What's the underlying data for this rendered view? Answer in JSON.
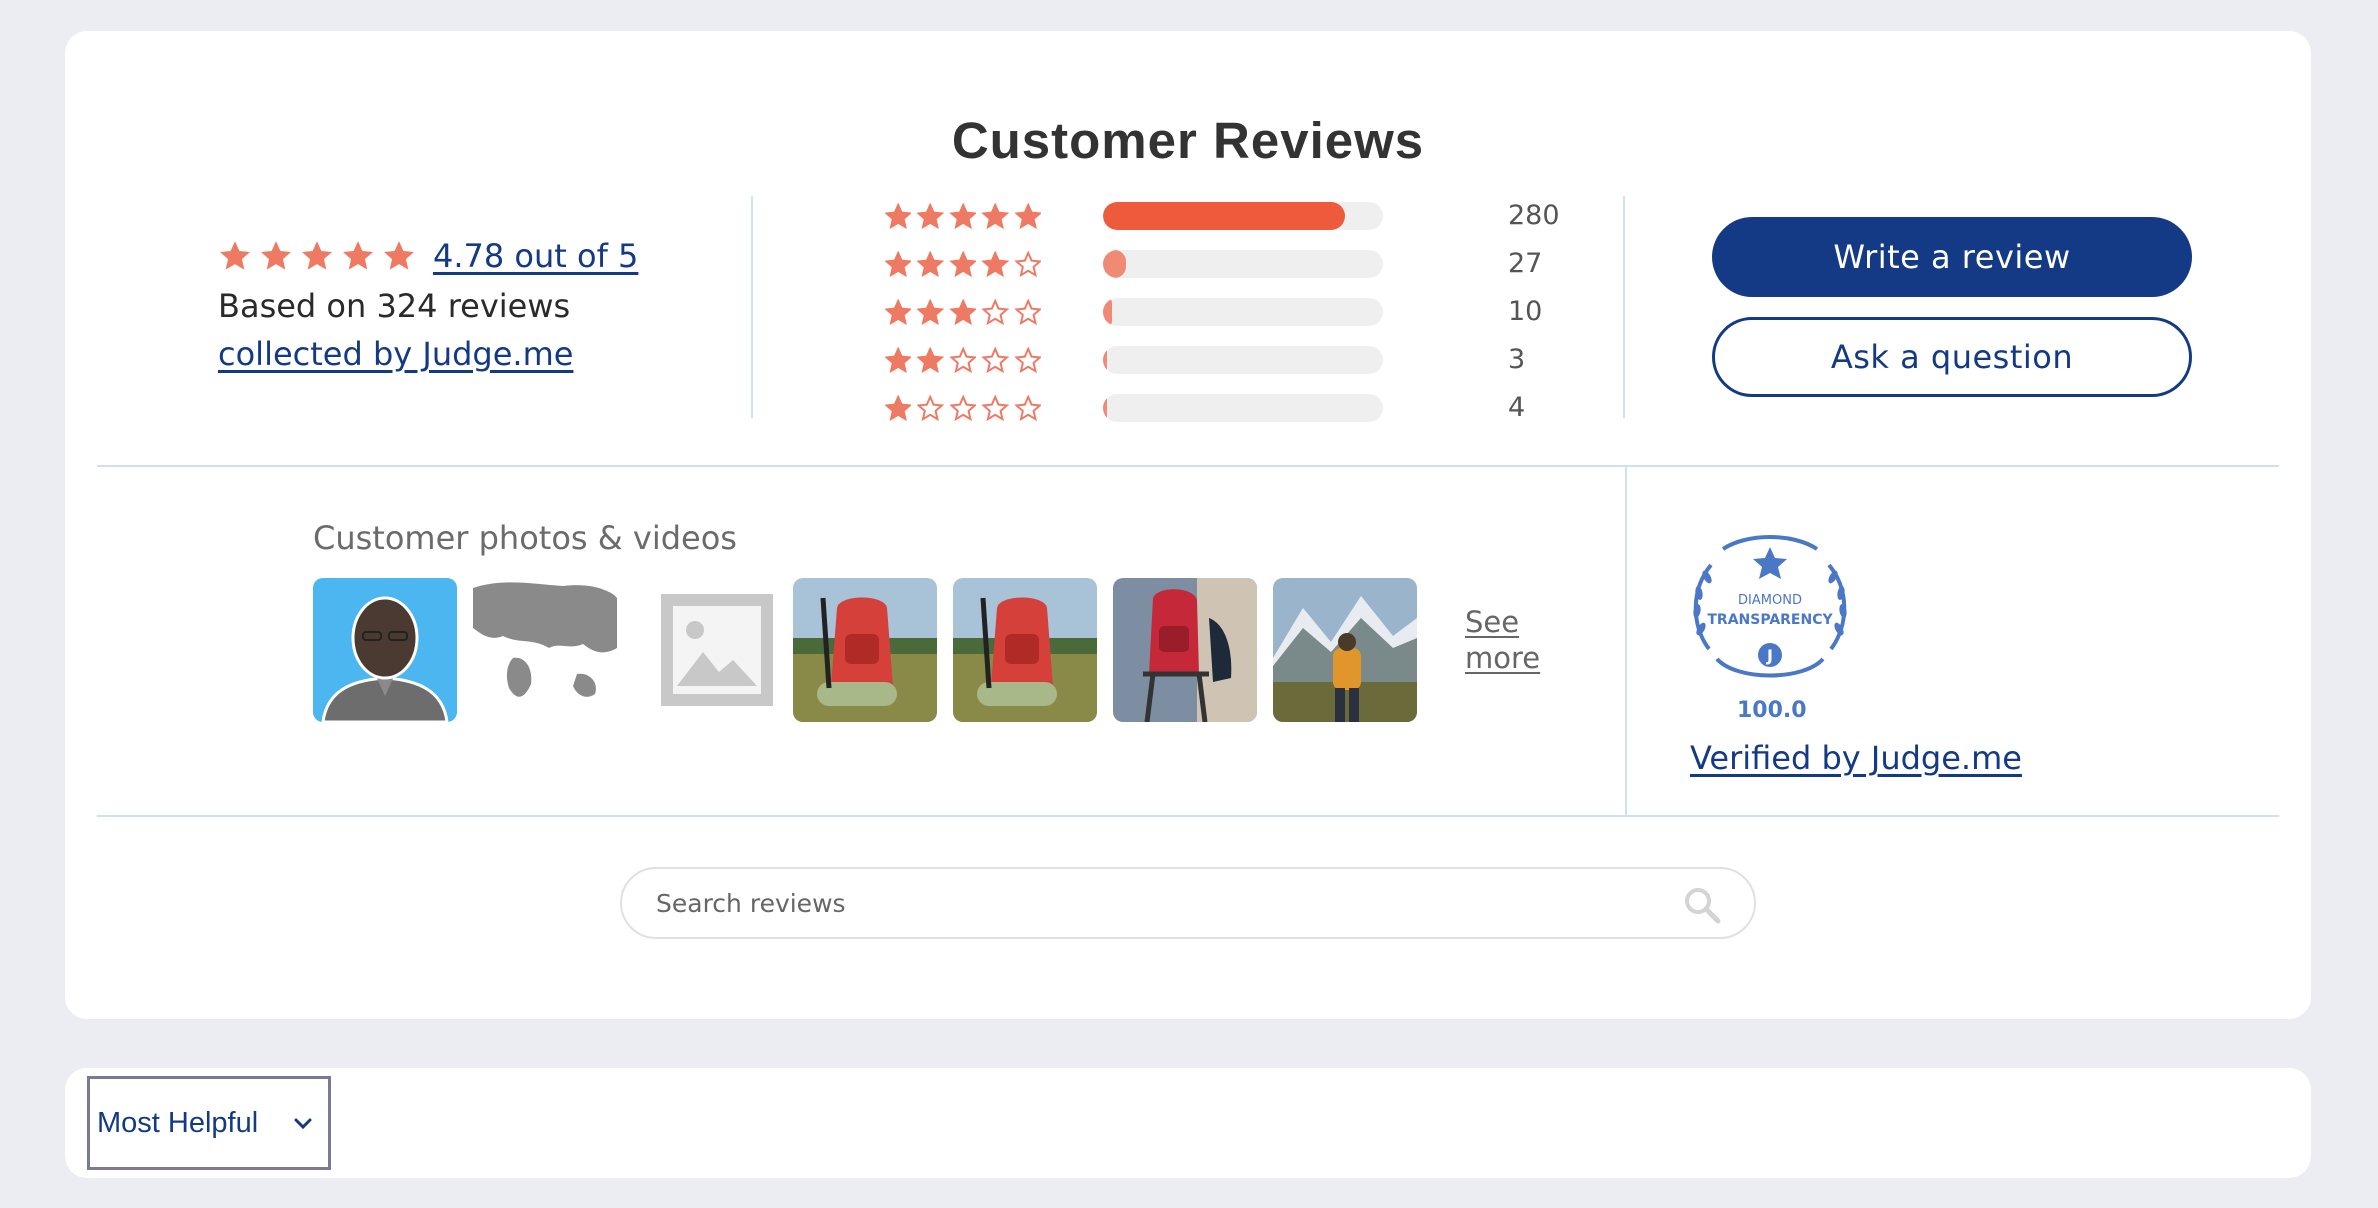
{
  "colors": {
    "star": "#ee7a63",
    "bar_5": "#ee5a3c",
    "bar_other": "#f08a75",
    "brand": "#143a85",
    "badge": "#4a78c6"
  },
  "reviews": {
    "title": "Customer Reviews",
    "summary": {
      "average_text": "4.78 out of 5",
      "average_stars": 5,
      "based_on": "Based on 324 reviews",
      "collected_by": "collected by Judge.me"
    },
    "histogram": [
      {
        "stars": 5,
        "count": "280",
        "fraction": 0.864
      },
      {
        "stars": 4,
        "count": "27",
        "fraction": 0.083
      },
      {
        "stars": 3,
        "count": "10",
        "fraction": 0.031
      },
      {
        "stars": 2,
        "count": "3",
        "fraction": 0.009
      },
      {
        "stars": 1,
        "count": "4",
        "fraction": 0.012
      }
    ],
    "write_review_label": "Write a review",
    "ask_question_label": "Ask a question",
    "media": {
      "heading": "Customer photos & videos",
      "thumbnails": [
        "person-portrait",
        "world-map",
        "image-placeholder",
        "red-backpack-sleeping-mat",
        "red-backpack-sleeping-mat",
        "red-backpack-on-chair",
        "hiker-in-mountains"
      ],
      "see_more": "See more"
    },
    "badge": {
      "line1": "DIAMOND",
      "line2": "TRANSPARENCY",
      "letter": "J",
      "score": "100.0",
      "verified_label": "Verified by Judge.me"
    },
    "search": {
      "placeholder": "Search reviews",
      "value": ""
    }
  },
  "sort": {
    "selected": "Most Helpful"
  }
}
